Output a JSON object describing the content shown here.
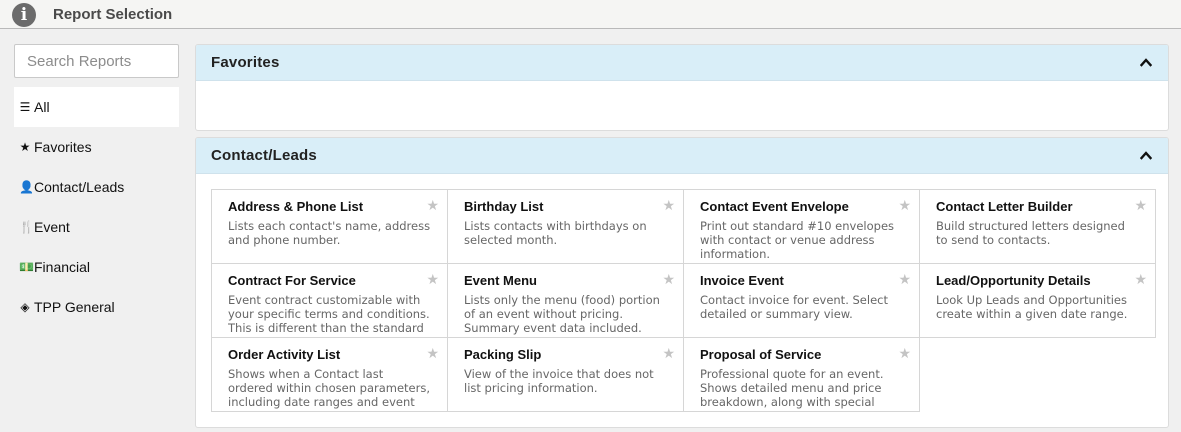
{
  "window": {
    "title": "Report Selection",
    "icon": "info-icon"
  },
  "sidebar": {
    "search_placeholder": "Search Reports",
    "items": [
      {
        "label": "All",
        "icon": "menu-icon",
        "glyph": "☰"
      },
      {
        "label": "Favorites",
        "icon": "star-icon",
        "glyph": "★"
      },
      {
        "label": "Contact/Leads",
        "icon": "user-icon",
        "glyph": "👤"
      },
      {
        "label": "Event",
        "icon": "utensils-icon",
        "glyph": "🍴"
      },
      {
        "label": "Financial",
        "icon": "money-icon",
        "glyph": "💵"
      },
      {
        "label": "TPP General",
        "icon": "cube-icon",
        "glyph": "◈"
      }
    ],
    "active_index": 0
  },
  "panels": {
    "favorites": {
      "title": "Favorites"
    },
    "contact_leads": {
      "title": "Contact/Leads",
      "reports": [
        {
          "name": "Address & Phone List",
          "desc": "Lists each contact's name, address and phone number."
        },
        {
          "name": "Birthday List",
          "desc": "Lists contacts with birthdays on selected month."
        },
        {
          "name": "Contact Event Envelope",
          "desc": "Print out standard #10 envelopes with contact or venue address information."
        },
        {
          "name": "Contact Letter Builder",
          "desc": "Build structured letters designed to send to contacts."
        },
        {
          "name": "Contract For Service",
          "desc": "Event contract customizable with your specific terms and conditions. This is different than the standard formal contract."
        },
        {
          "name": "Event Menu",
          "desc": "Lists only the menu (food) portion of an event without pricing. Summary event data included."
        },
        {
          "name": "Invoice Event",
          "desc": "Contact invoice for event. Select detailed or summary view."
        },
        {
          "name": "Lead/Opportunity Details",
          "desc": "Look Up Leads and Opportunities create within a given date range."
        },
        {
          "name": "Order Activity List",
          "desc": "Shows when a Contact last ordered within chosen parameters, including date ranges and event types."
        },
        {
          "name": "Packing Slip",
          "desc": "View of the invoice that does not list pricing information."
        },
        {
          "name": "Proposal of Service",
          "desc": "Professional quote for an event. Shows detailed menu and price breakdown, along with special notes."
        }
      ]
    }
  },
  "colors": {
    "panel_header": "#d9eef8",
    "background": "#f0f0f0",
    "star_inactive": "#c4c4c4"
  }
}
